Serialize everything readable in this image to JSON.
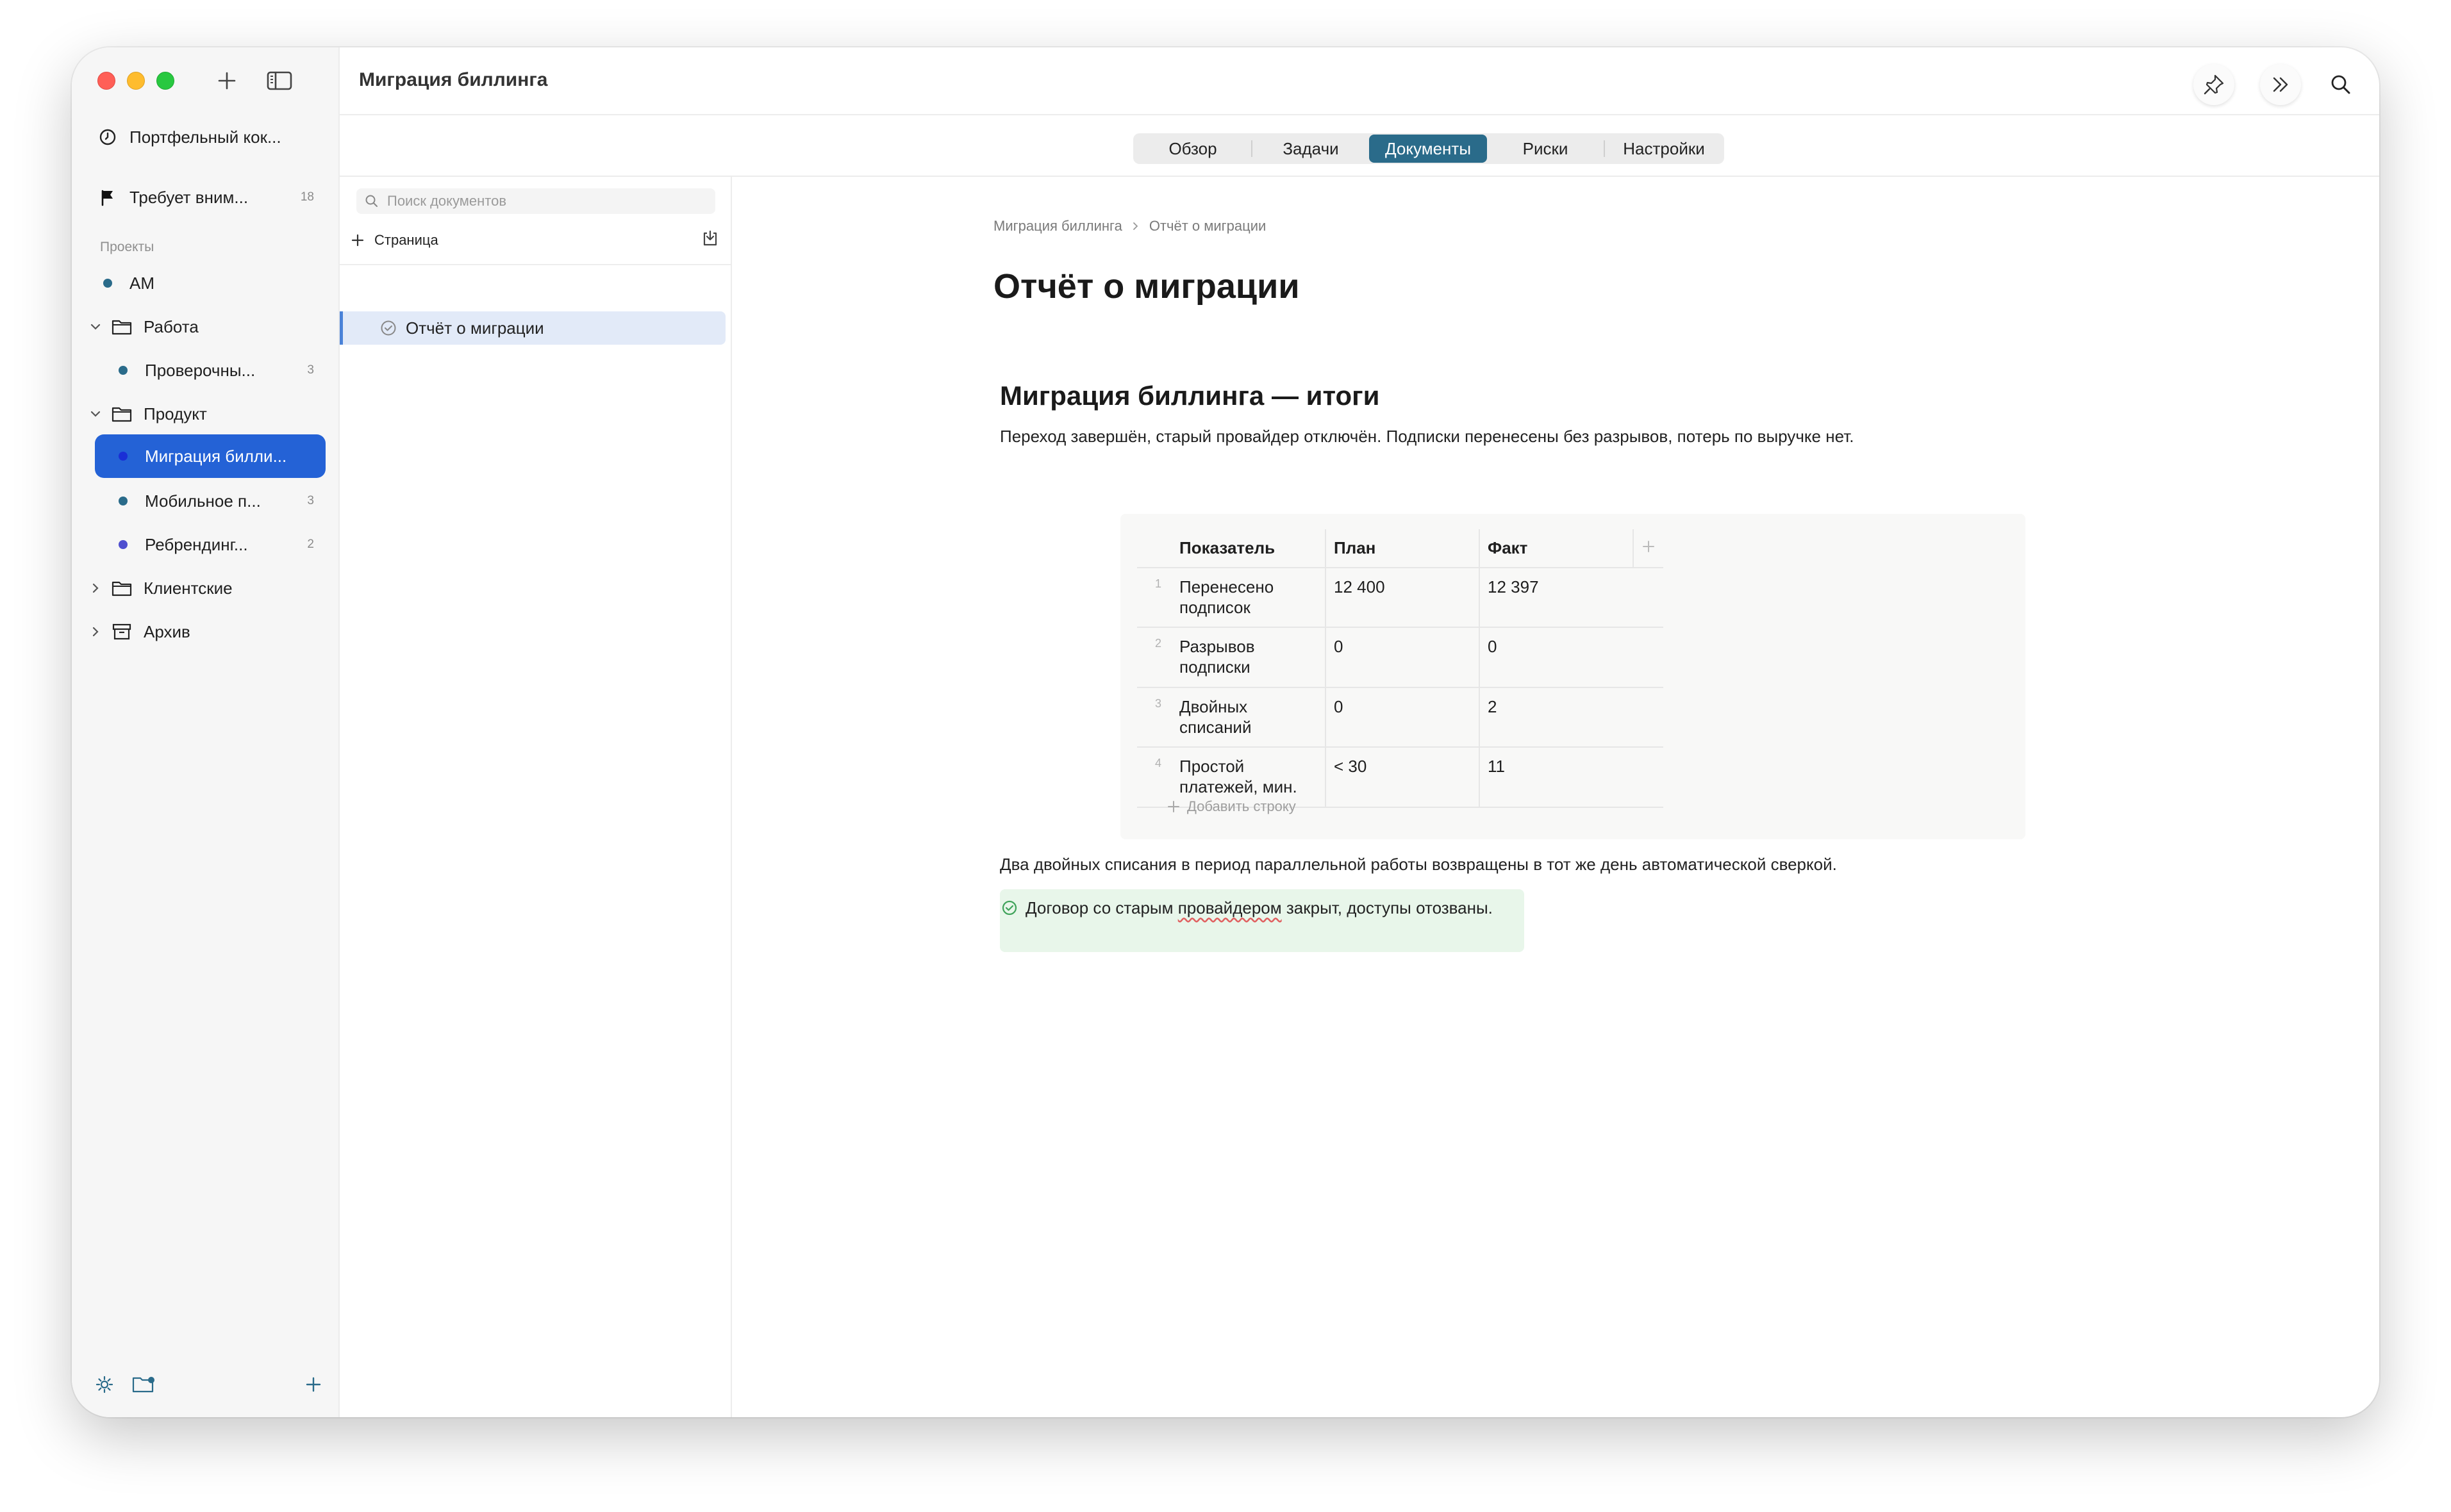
{
  "window": {
    "title": "Миграция биллинга"
  },
  "sidebar": {
    "top_items": [
      {
        "label": "Портфельный кок...",
        "icon": "clock-icon"
      },
      {
        "label": "Требует вним...",
        "icon": "flag-icon",
        "count": "18"
      }
    ],
    "projects_header": "Проекты",
    "tree": [
      {
        "label": "AM",
        "type": "project",
        "color": "#2a6b8a"
      },
      {
        "label": "Работа",
        "type": "folder",
        "expanded": true
      },
      {
        "label": "Проверочны...",
        "type": "project",
        "color": "#2a6b8a",
        "count": "3"
      },
      {
        "label": "Продукт",
        "type": "folder",
        "expanded": true
      },
      {
        "label": "Миграция билли...",
        "type": "project",
        "color": "#1f3fcf",
        "active": true
      },
      {
        "label": "Мобильное п...",
        "type": "project",
        "color": "#2a6b8a",
        "count": "3"
      },
      {
        "label": "Ребрендинг...",
        "type": "project",
        "color": "#4f4fcf",
        "count": "2"
      },
      {
        "label": "Клиентские",
        "type": "folder",
        "expanded": false
      },
      {
        "label": "Архив",
        "type": "archive",
        "expanded": false
      }
    ]
  },
  "tabs": [
    {
      "label": "Обзор"
    },
    {
      "label": "Задачи"
    },
    {
      "label": "Документы",
      "selected": true
    },
    {
      "label": "Риски"
    },
    {
      "label": "Настройки"
    }
  ],
  "docs_panel": {
    "search_placeholder": "Поиск документов",
    "add_page_label": "Страница",
    "items": [
      {
        "label": "Отчёт о миграции",
        "selected": true
      }
    ]
  },
  "document": {
    "breadcrumb": [
      "Миграция биллинга",
      "Отчёт о миграции"
    ],
    "title": "Отчёт о миграции",
    "heading": "Миграция биллинга — итоги",
    "intro": "Переход завершён, старый провайдер отключён. Подписки перенесены без разрывов, потерь по выручке нет.",
    "table": {
      "headers": [
        "Показатель",
        "План",
        "Факт"
      ],
      "rows": [
        {
          "num": "1",
          "metric": "Перенесено подписок",
          "plan": "12 400",
          "fact": "12 397"
        },
        {
          "num": "2",
          "metric": "Разрывов подписки",
          "plan": "0",
          "fact": "0"
        },
        {
          "num": "3",
          "metric": "Двойных списаний",
          "plan": "0",
          "fact": "2"
        },
        {
          "num": "4",
          "metric": "Простой платежей, мин.",
          "plan": "< 30",
          "fact": "11"
        }
      ],
      "add_row_label": "Добавить строку"
    },
    "after_table": "Два двойных списания в период параллельной работы возвращены в тот же день автоматической сверкой.",
    "callout": {
      "before": "Договор со старым ",
      "misspelled": "провайдером",
      "after": " закрыт, доступы отозваны."
    }
  },
  "colors": {
    "accent": "#2462d6",
    "tab_selected": "#2a6b8a",
    "callout_bg": "#e8f6ea",
    "callout_icon": "#3fa35a"
  }
}
